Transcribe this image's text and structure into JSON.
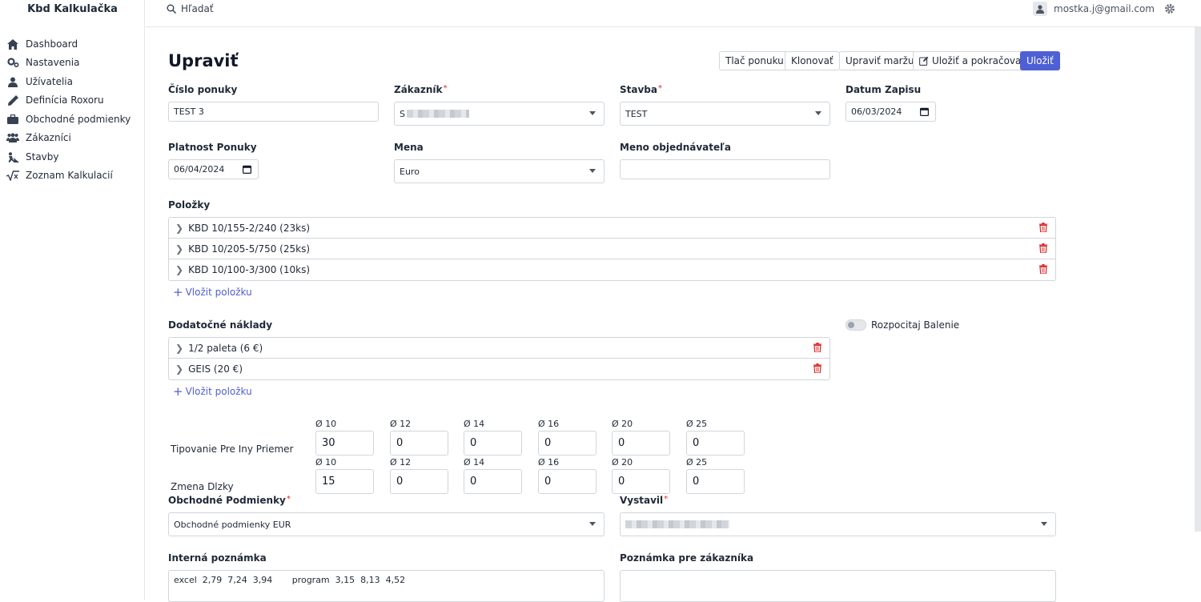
{
  "app": {
    "title": "Kbd Kalkulačka"
  },
  "sidebar": {
    "items": [
      {
        "label": "Dashboard",
        "icon": "home-icon"
      },
      {
        "label": "Nastavenia",
        "icon": "gears-icon"
      },
      {
        "label": "Užívatelia",
        "icon": "user-icon"
      },
      {
        "label": "Definícia Roxoru",
        "icon": "pen-icon"
      },
      {
        "label": "Obchodné podmienky",
        "icon": "briefcase-icon"
      },
      {
        "label": "Zákazníci",
        "icon": "users-icon"
      },
      {
        "label": "Stavby",
        "icon": "construction-icon"
      },
      {
        "label": "Zoznam Kalkulacií",
        "icon": "square-root-icon"
      }
    ]
  },
  "topbar": {
    "search_label": "Hľadať",
    "user_email": "mostka.j@gmail.com"
  },
  "page": {
    "title": "Upraviť",
    "actions": {
      "print": "Tlač ponuku",
      "clone": "Klonovať",
      "edit_margin": "Upraviť maržu",
      "save_continue": "Uložiť a pokračovať",
      "save": "Uložiť"
    }
  },
  "form": {
    "offer_number": {
      "label": "Číslo ponuky",
      "value": "TEST 3"
    },
    "customer": {
      "label": "Zákazník",
      "value": "S"
    },
    "building": {
      "label": "Stavba",
      "value": "TEST"
    },
    "record_date": {
      "label": "Datum Zapisu",
      "value": "06/03/2024"
    },
    "validity": {
      "label": "Platnost Ponuky",
      "value": "06/04/2024"
    },
    "currency": {
      "label": "Mena",
      "value": "Euro"
    },
    "orderer_name": {
      "label": "Meno objednávateľa",
      "value": ""
    }
  },
  "items": {
    "label": "Položky",
    "rows": [
      "KBD 10/155-2/240 (23ks)",
      "KBD 10/205-5/750 (25ks)",
      "KBD 10/100-3/300 (10ks)"
    ],
    "add_label": "Vložit položku"
  },
  "extra_costs": {
    "label": "Dodatočné náklady",
    "rows": [
      "1/2 paleta (6 €)",
      "GEIS (20 €)"
    ],
    "add_label": "Vložit položku",
    "toggle_label": "Rozpocitaj Balenie",
    "toggle_on": false
  },
  "diameters": {
    "headers": [
      "Ø 10",
      "Ø 12",
      "Ø 14",
      "Ø 16",
      "Ø 20",
      "Ø 25"
    ],
    "rows": [
      {
        "label": "Tipovanie Pre Iny Priemer",
        "values": [
          "30",
          "0",
          "0",
          "0",
          "0",
          "0"
        ]
      },
      {
        "label": "Zmena Dlzky",
        "values": [
          "15",
          "0",
          "0",
          "0",
          "0",
          "0"
        ]
      }
    ]
  },
  "terms": {
    "label": "Obchodné Podmienky",
    "value": "Obchodné podmienky EUR"
  },
  "issued_by": {
    "label": "Vystavil",
    "value": ""
  },
  "internal_note": {
    "label": "Interná poznámka",
    "value": "excel  2,79  7,24  3,94       program  3,15  8,13  4,52"
  },
  "customer_note": {
    "label": "Poznámka pre zákazníka",
    "value": ""
  },
  "colors": {
    "primary": "#4f5fd6",
    "danger": "#dc2626",
    "border": "#d1d5db"
  }
}
